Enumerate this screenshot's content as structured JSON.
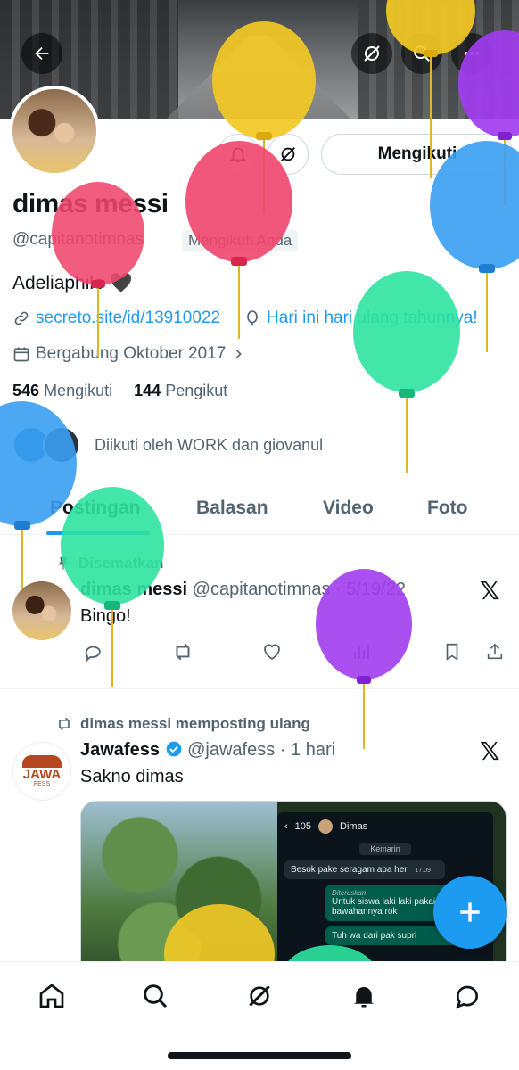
{
  "colors": {
    "accent": "#1d9bf0",
    "text": "#0f1419",
    "muted": "#536471",
    "border": "#cfd9de"
  },
  "header": {
    "back_icon": "arrow-left-icon",
    "grok_icon": "grok-icon",
    "search_icon": "search-icon",
    "more_icon": "more-icon"
  },
  "profile": {
    "name": "dimas messi",
    "handle": "@capitanotimnas",
    "follows_you_badge": "Mengikuti Anda",
    "bio": "Adeliaphile 🖤",
    "link": "secreto.site/id/13910022",
    "birthday": "Hari ini hari ulang tahunnya!",
    "joined": "Bergabung Oktober 2017",
    "following_count": "546",
    "following_label": "Mengikuti",
    "followers_count": "144",
    "followers_label": "Pengikut",
    "followed_by": "Diikuti oleh WORK dan giovanul",
    "follow_button": "Mengikuti"
  },
  "tabs": [
    "Postingan",
    "Balasan",
    "Video",
    "Foto"
  ],
  "posts": [
    {
      "context": "Disematkan",
      "name": "dimas messi",
      "handle": "@capitanotimnas",
      "time": "5/19/22",
      "text": "Bingo!"
    },
    {
      "context": "dimas messi memposting ulang",
      "name": "Jawafess",
      "handle": "@jawafess",
      "time": "1 hari",
      "text": "Sakno dimas",
      "avatar_text": "JAWA",
      "avatar_sub": "FESS"
    }
  ],
  "media_chat": {
    "count": "105",
    "contact": "Dimas",
    "day": "Kemarin",
    "messages": [
      {
        "dir": "in",
        "text": "Besok pake seragam apa her",
        "time": "17.09"
      },
      {
        "dir": "out",
        "forwarded": "Diteruskan",
        "text": "Untuk siswa laki laki pakai putih bawahannya rok"
      },
      {
        "dir": "out",
        "text": "Tuh wa dari pak supri"
      }
    ]
  },
  "fab": {
    "icon": "plus-icon"
  },
  "bottom_nav": [
    "home-icon",
    "search-icon",
    "grok-icon",
    "notifications-icon",
    "messages-icon"
  ]
}
